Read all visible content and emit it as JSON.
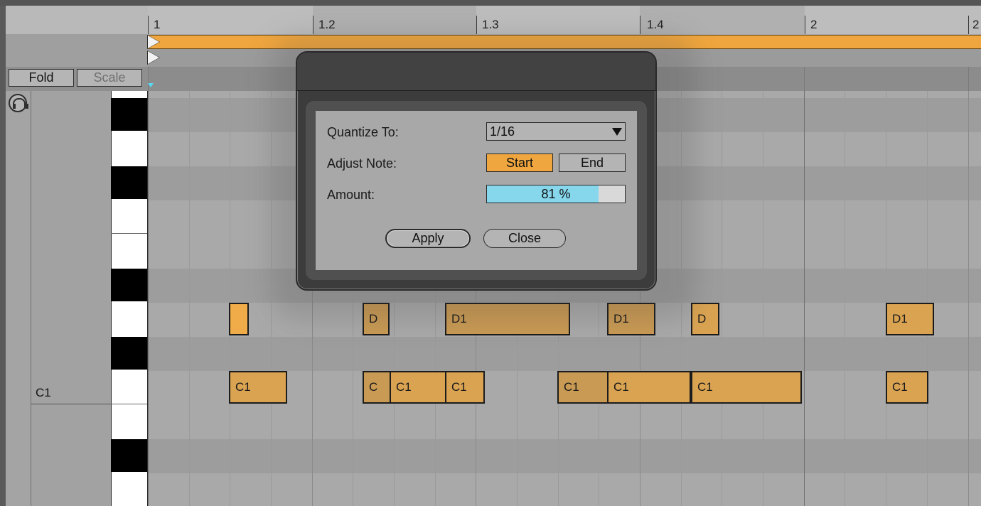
{
  "ruler": {
    "markers": [
      "1",
      "1.2",
      "1.3",
      "1.4",
      "2",
      "2"
    ]
  },
  "toolbar": {
    "fold_label": "Fold",
    "scale_label": "Scale"
  },
  "keyboard": {
    "c1_label": "C1"
  },
  "notes": {
    "d_row": [
      "",
      "D",
      "D1",
      "D1",
      "D",
      "D1"
    ],
    "c_row": [
      "C1",
      "C",
      "C1",
      "C1",
      "C1",
      "C1",
      "C1",
      "C1"
    ]
  },
  "dialog": {
    "quantize_label": "Quantize To:",
    "quantize_value": "1/16",
    "adjust_label": "Adjust Note:",
    "start_label": "Start",
    "end_label": "End",
    "amount_label": "Amount:",
    "amount_text": "81 %",
    "amount_fraction": 0.81,
    "apply_label": "Apply",
    "close_label": "Close"
  },
  "colors": {
    "accent_orange": "#f0a63e",
    "note_orange": "#d9a352",
    "slider_blue": "#86d6ec"
  }
}
